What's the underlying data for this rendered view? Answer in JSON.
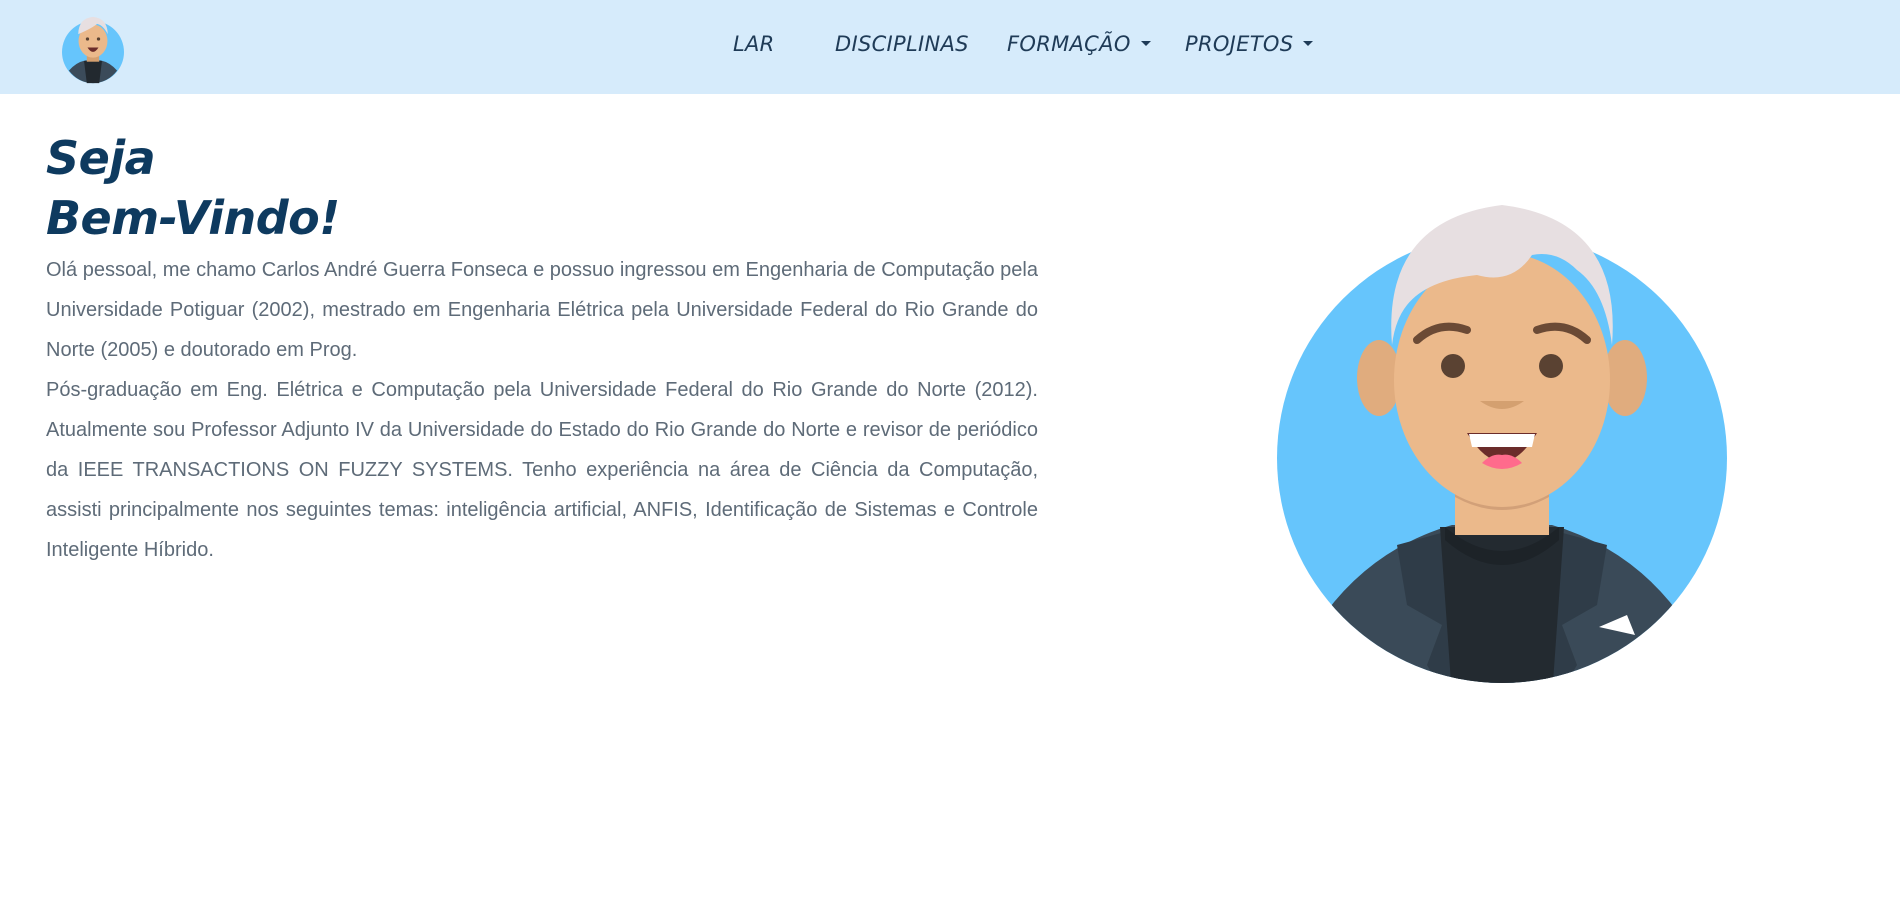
{
  "navbar": {
    "links": [
      {
        "label": "LAR"
      },
      {
        "label": "DISCIPLINAS"
      },
      {
        "label": "FORMAÇÃO"
      },
      {
        "label": "PROJETOS"
      }
    ]
  },
  "hero": {
    "title_line1": "Seja",
    "title_line2": "Bem-Vindo!",
    "paragraph1": "Olá pessoal, me chamo Carlos André Guerra Fonseca e possuo ingressou em Engenharia de Computação pela Universidade Potiguar (2002), mestrado em Engenharia Elétrica pela Universidade Federal do Rio Grande do Norte (2005) e doutorado em Prog.",
    "paragraph2": "Pós-graduação em Eng. Elétrica e Computação pela Universidade Federal do Rio Grande do Norte (2012). Atualmente sou Professor Adjunto IV da Universidade do Estado do Rio Grande do Norte e revisor de periódico da IEEE TRANSACTIONS ON FUZZY SYSTEMS. Tenho experiência na área de Ciência da Computação, assisti principalmente nos seguintes temas: inteligência artificial, ANFIS, Identificação de Sistemas e Controle Inteligente Híbrido."
  },
  "colors": {
    "navbar_bg": "#d6ebfb",
    "title": "#0e3a5f",
    "body_text": "#5e6b78",
    "avatar_bg": "#66c5fc"
  },
  "icons": {
    "nav_logo": "avatar-logo-icon",
    "hero_image": "avatar-illustration",
    "dropdown": "caret-down-icon"
  }
}
